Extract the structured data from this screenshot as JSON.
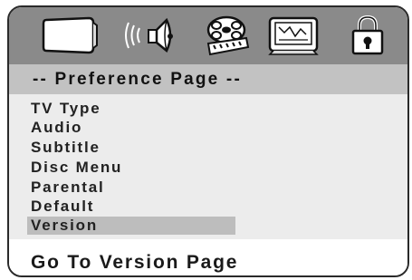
{
  "icons": [
    {
      "name": "tv-screen-icon",
      "label": "TV Setup"
    },
    {
      "name": "speaker-icon",
      "label": "Audio Setup"
    },
    {
      "name": "film-reel-icon",
      "label": "Video Setup"
    },
    {
      "name": "preference-screen-icon",
      "label": "Preference"
    },
    {
      "name": "lock-icon",
      "label": "Password"
    }
  ],
  "header": {
    "title": "-- Preference Page --"
  },
  "menu": {
    "items": [
      {
        "label": "TV Type",
        "selected": false
      },
      {
        "label": "Audio",
        "selected": false
      },
      {
        "label": "Subtitle",
        "selected": false
      },
      {
        "label": "Disc Menu",
        "selected": false
      },
      {
        "label": "Parental",
        "selected": false
      },
      {
        "label": "Default",
        "selected": false
      },
      {
        "label": "Version",
        "selected": true
      }
    ]
  },
  "footer": {
    "text": "Go To Version Page"
  },
  "colors": {
    "icon_bar": "#8a8a8a",
    "header_bg": "#c2c2c2",
    "menu_bg": "#ececec",
    "selected_bg": "#bdbdbd"
  }
}
